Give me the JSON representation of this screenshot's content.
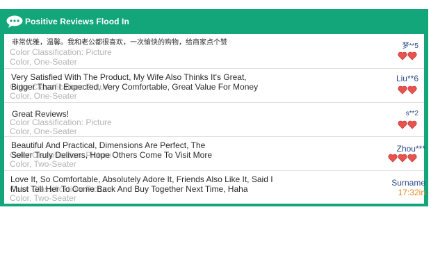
{
  "header": {
    "title": "Positive Reviews Flood In",
    "icon": "speech-bubble-icon",
    "accent": "#12a67a"
  },
  "reviews": [
    {
      "text": "非常优雅，温馨。我和老公都很喜欢，一次愉快的购物，给商家点个赞",
      "meta1": "Color Classification: Picture",
      "meta2": "Color, One-Seater",
      "user": "梦**5",
      "hearts": 2
    },
    {
      "text": "Very Satisfied With The Product, My Wife Also Thinks It's Great,\nBigger Than I Expected, Very Comfortable, Great Value For Money",
      "meta1": "Color Classification: Picture",
      "meta2": "Color, One-Seater",
      "user": "Liu**6",
      "hearts": 2
    },
    {
      "text": "Great Reviews!",
      "meta1": "Color Classification: Picture",
      "meta2": "Color, One-Seater",
      "user": "s**2",
      "hearts": 2
    },
    {
      "text": "Beautiful And Practical, Dimensions Are Perfect, The\nSeller Truly Delivers, Hope Others Come To Visit More",
      "meta1": "Color Classification: Picture",
      "meta2": "Color, Two-Seater",
      "user": "Zhou***",
      "hearts": 3
    },
    {
      "text": "Love It, So Comfortable, Absolutely Adore It, Friends Also Like It, Said I\nMust Tell Her To Come Back And Buy Together Next Time, Haha",
      "meta1": "Color Classification: Picture",
      "meta2": "Color, Two-Seater",
      "user": "Surname",
      "time": "17:32in",
      "hearts": 0
    }
  ]
}
